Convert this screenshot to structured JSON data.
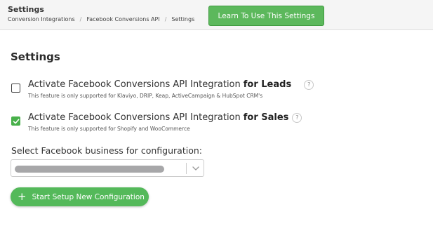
{
  "header": {
    "title": "Settings",
    "breadcrumb": [
      "Conversion Integrations",
      "Facebook Conversions API",
      "Settings"
    ],
    "breadcrumb_separator": "/",
    "learn_button_label": "Learn To Use This Settings"
  },
  "main": {
    "title": "Settings",
    "options": [
      {
        "label_prefix": "Activate Facebook Conversions API Integration",
        "label_emphasis": "for Leads",
        "help": "?",
        "description": "This feature is only supported for Klaviyo, DRIP, Keap, ActiveCampaign & HubSpot CRM's",
        "checked": false
      },
      {
        "label_prefix": "Activate Facebook Conversions API Integration",
        "label_emphasis": "for Sales",
        "help": "?",
        "description": "This feature is only supported for Shopify and WooCommerce",
        "checked": true
      }
    ],
    "select_label": "Select Facebook business for configuration:",
    "setup_button_label": "Start Setup New Configuration",
    "setup_button_icon": "+"
  },
  "colors": {
    "accent_green": "#5cb85c",
    "checkbox_checked": "#48b04a",
    "header_bg": "#f5f5f5"
  }
}
